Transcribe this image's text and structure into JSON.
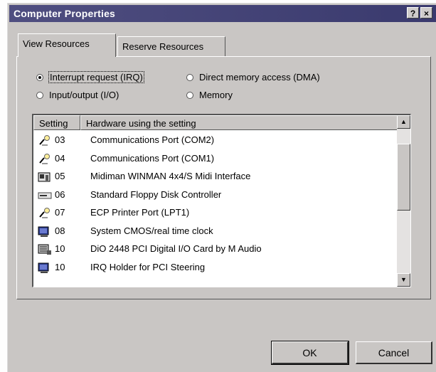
{
  "window": {
    "title": "Computer Properties",
    "help_button": "?",
    "close_button": "×"
  },
  "tabs": [
    {
      "label": "View Resources",
      "active": true
    },
    {
      "label": "Reserve Resources",
      "active": false
    }
  ],
  "radios": [
    {
      "label": "Interrupt request (IRQ)",
      "checked": true
    },
    {
      "label": "Input/output (I/O)",
      "checked": false
    },
    {
      "label": "Direct memory access (DMA)",
      "checked": false
    },
    {
      "label": "Memory",
      "checked": false
    }
  ],
  "list": {
    "columns": [
      "Setting",
      "Hardware using the setting"
    ],
    "rows": [
      {
        "icon": "port-icon",
        "setting": "03",
        "hardware": "Communications Port (COM2)"
      },
      {
        "icon": "port-icon",
        "setting": "04",
        "hardware": "Communications Port (COM1)"
      },
      {
        "icon": "midi-device-icon",
        "setting": "05",
        "hardware": "Midiman WINMAN 4x4/S Midi Interface"
      },
      {
        "icon": "floppy-controller-icon",
        "setting": "06",
        "hardware": "Standard Floppy Disk Controller"
      },
      {
        "icon": "port-icon",
        "setting": "07",
        "hardware": "ECP Printer Port (LPT1)"
      },
      {
        "icon": "system-device-icon",
        "setting": "08",
        "hardware": "System CMOS/real time clock"
      },
      {
        "icon": "pci-card-icon",
        "setting": "10",
        "hardware": "DiO 2448 PCI Digital I/O Card by M Audio"
      },
      {
        "icon": "system-device-icon",
        "setting": "10",
        "hardware": "IRQ Holder for PCI Steering"
      }
    ]
  },
  "buttons": {
    "ok": "OK",
    "cancel": "Cancel"
  },
  "colors": {
    "title_bar": "#3f3f74",
    "face": "#c9c6c4"
  }
}
